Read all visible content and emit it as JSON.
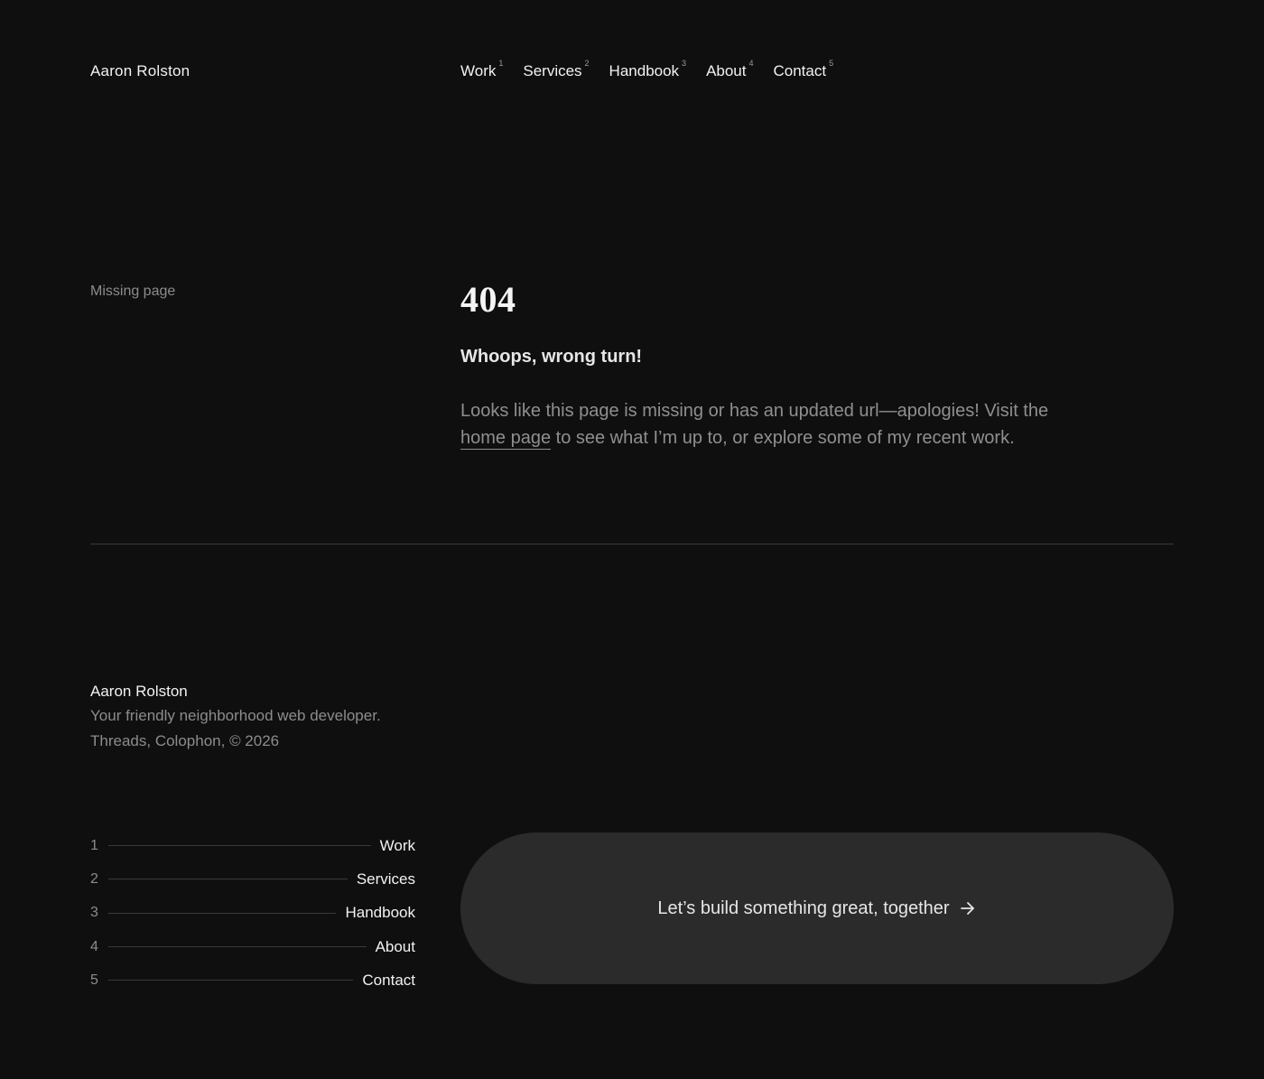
{
  "header": {
    "brand": "Aaron Rolston",
    "nav": [
      {
        "label": "Work",
        "index": "1"
      },
      {
        "label": "Services",
        "index": "2"
      },
      {
        "label": "Handbook",
        "index": "3"
      },
      {
        "label": "About",
        "index": "4"
      },
      {
        "label": "Contact",
        "index": "5"
      }
    ]
  },
  "error": {
    "section_label": "Missing page",
    "code": "404",
    "heading": "Whoops, wrong turn!",
    "message_before": "Looks like this page is missing or has an updated url—apologies! Visit the ",
    "home_link": "home page",
    "message_after": " to see what I’m up to, or explore some of my recent work."
  },
  "footer": {
    "name": "Aaron Rolston",
    "tagline": "Your friendly neighborhood web developer.",
    "links": {
      "threads": "Threads",
      "colophon": "Colophon",
      "copyright": "© 2026"
    },
    "nav": [
      {
        "num": "1",
        "label": "Work"
      },
      {
        "num": "2",
        "label": "Services"
      },
      {
        "num": "3",
        "label": "Handbook"
      },
      {
        "num": "4",
        "label": "About"
      },
      {
        "num": "5",
        "label": "Contact"
      }
    ],
    "cta": {
      "label": "Let’s build something great, together",
      "icon": "arrow-right-icon"
    }
  },
  "colors": {
    "background": "#0f0f0f",
    "text": "#f2f2f2",
    "muted": "#8c8c8c",
    "cta_background": "#2b2b2b",
    "divider": "#3a3a3a"
  }
}
